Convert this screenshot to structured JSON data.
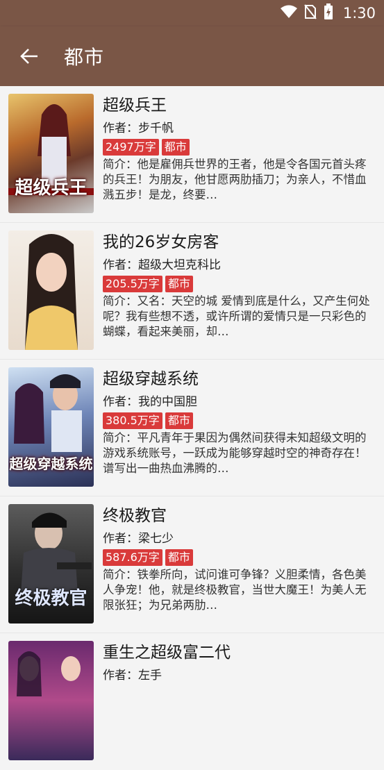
{
  "status_bar": {
    "time": "1:30"
  },
  "app_bar": {
    "title": "都市"
  },
  "books": [
    {
      "title": "超级兵王",
      "author_label": "作者：步千帆",
      "word_count": "2497万字",
      "category": "都市",
      "intro": "简介：他是雇佣兵世界的王者，他是令各国元首头疼的兵王！为朋友，他甘愿两肋插刀；为亲人，不惜血溅五步！是龙，终要…",
      "cover_text": "超级兵王"
    },
    {
      "title": "我的26岁女房客",
      "author_label": "作者：超级大坦克科比",
      "word_count": "205.5万字",
      "category": "都市",
      "intro": "简介：又名：天空的城 爱情到底是什么，又产生何处呢？我有些想不透，或许所谓的爱情只是一只彩色的蝴蝶，看起来美丽，却…",
      "cover_text": ""
    },
    {
      "title": "超级穿越系统",
      "author_label": "作者：我的中国胆",
      "word_count": "380.5万字",
      "category": "都市",
      "intro": "简介：平凡青年于果因为偶然间获得未知超级文明的游戏系统账号，一跃成为能够穿越时空的神奇存在！谱写出一曲热血沸腾的…",
      "cover_text": "超级穿越系统"
    },
    {
      "title": "终极教官",
      "author_label": "作者：梁七少",
      "word_count": "587.6万字",
      "category": "都市",
      "intro": "简介：铁拳所向，试问谁可争锋？义胆柔情，各色美人争宠！他，就是终极教官，当世大魔王！为美人无限张狂；为兄弟两肋…",
      "cover_text": "终极教官"
    },
    {
      "title": "重生之超级富二代",
      "author_label": "作者：左手",
      "word_count": "",
      "category": "",
      "intro": "",
      "cover_text": ""
    }
  ],
  "colors": {
    "primary": "#7a5646",
    "tag": "#d93a3a"
  }
}
